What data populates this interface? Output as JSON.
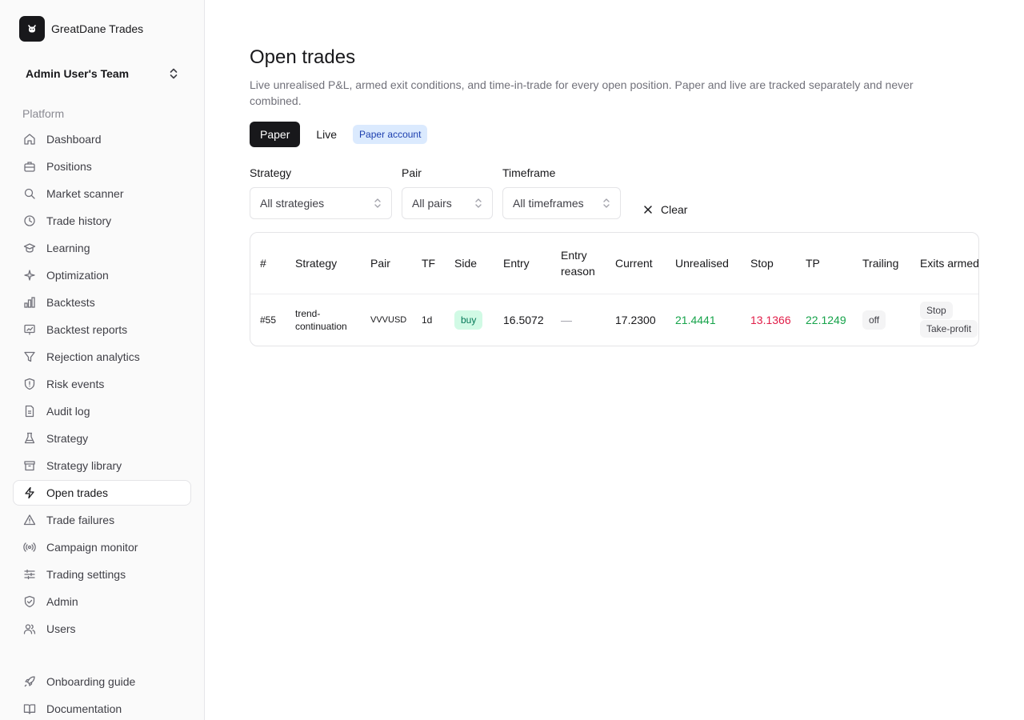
{
  "brand": {
    "name": "GreatDane Trades",
    "logo_icon": "dog-icon"
  },
  "team": {
    "name": "Admin User's Team"
  },
  "sidebar": {
    "group_label": "Platform",
    "items": [
      {
        "label": "Dashboard",
        "icon": "home-icon"
      },
      {
        "label": "Positions",
        "icon": "briefcase-icon"
      },
      {
        "label": "Market scanner",
        "icon": "search-icon"
      },
      {
        "label": "Trade history",
        "icon": "clock-icon"
      },
      {
        "label": "Learning",
        "icon": "graduation-cap-icon"
      },
      {
        "label": "Optimization",
        "icon": "sparkles-icon"
      },
      {
        "label": "Backtests",
        "icon": "bar-chart-icon"
      },
      {
        "label": "Backtest reports",
        "icon": "presentation-chart-icon"
      },
      {
        "label": "Rejection analytics",
        "icon": "filter-icon"
      },
      {
        "label": "Risk events",
        "icon": "shield-alert-icon"
      },
      {
        "label": "Audit log",
        "icon": "file-text-icon"
      },
      {
        "label": "Strategy",
        "icon": "flask-icon"
      },
      {
        "label": "Strategy library",
        "icon": "archive-icon"
      },
      {
        "label": "Open trades",
        "icon": "zap-icon",
        "active": true
      },
      {
        "label": "Trade failures",
        "icon": "alert-triangle-icon"
      },
      {
        "label": "Campaign monitor",
        "icon": "radio-icon"
      },
      {
        "label": "Trading settings",
        "icon": "sliders-icon"
      },
      {
        "label": "Admin",
        "icon": "shield-check-icon"
      },
      {
        "label": "Users",
        "icon": "users-icon"
      }
    ],
    "bottom_items": [
      {
        "label": "Onboarding guide",
        "icon": "rocket-icon"
      },
      {
        "label": "Documentation",
        "icon": "book-open-icon"
      }
    ]
  },
  "page": {
    "title": "Open trades",
    "description": "Live unrealised P&L, armed exit conditions, and time-in-trade for every open position. Paper and live are tracked separately and never combined."
  },
  "mode": {
    "paper_label": "Paper",
    "live_label": "Live",
    "selected": "Paper",
    "account_badge": "Paper account"
  },
  "filters": {
    "strategy": {
      "label": "Strategy",
      "value": "All strategies"
    },
    "pair": {
      "label": "Pair",
      "value": "All pairs"
    },
    "timeframe": {
      "label": "Timeframe",
      "value": "All timeframes"
    },
    "clear_label": "Clear"
  },
  "table": {
    "columns": [
      "#",
      "Strategy",
      "Pair",
      "TF",
      "Side",
      "Entry",
      "Entry reason",
      "Current",
      "Unrealised",
      "Stop",
      "TP",
      "Trailing",
      "Exits armed"
    ],
    "rows": [
      {
        "id": "#55",
        "strategy": "trend-continuation",
        "pair": "VVVUSD",
        "tf": "1d",
        "side": "buy",
        "entry": "16.5072",
        "entry_reason": "—",
        "current": "17.2300",
        "unrealised": "21.4441",
        "stop": "13.1366",
        "tp": "22.1249",
        "trailing": "off",
        "exits_armed": [
          "Stop",
          "Take-profit"
        ]
      }
    ]
  },
  "colors": {
    "positive": "#16a34a",
    "negative": "#e11d48",
    "accent_dark": "#18181b",
    "badge_blue_bg": "#dbeafe"
  }
}
